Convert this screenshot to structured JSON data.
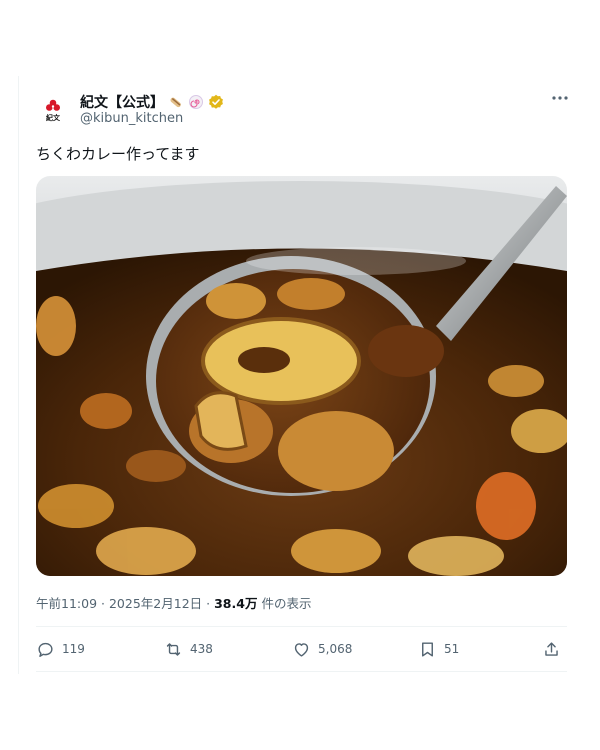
{
  "account": {
    "logo_text": "紀文",
    "display_name": "紀文【公式】",
    "handle": "@kibun_kitchen",
    "badges": [
      "chikuwa-emoji",
      "naruto-emoji",
      "verified-badge-gold"
    ]
  },
  "tweet": {
    "text": "ちくわカレー作ってます",
    "image_description_icon": "curry-ladle-photo"
  },
  "meta": {
    "time": "午前11:09",
    "sep1": "·",
    "date": "2025年2月12日",
    "sep2": "·",
    "views": "38.4万",
    "views_label": "件の表示"
  },
  "actions": {
    "replies": "119",
    "retweets": "438",
    "likes": "5,068",
    "bookmarks": "51"
  },
  "colors": {
    "text": "#0f1419",
    "muted": "#536471",
    "verified": "#e2b719",
    "logo_red": "#d7182a"
  }
}
